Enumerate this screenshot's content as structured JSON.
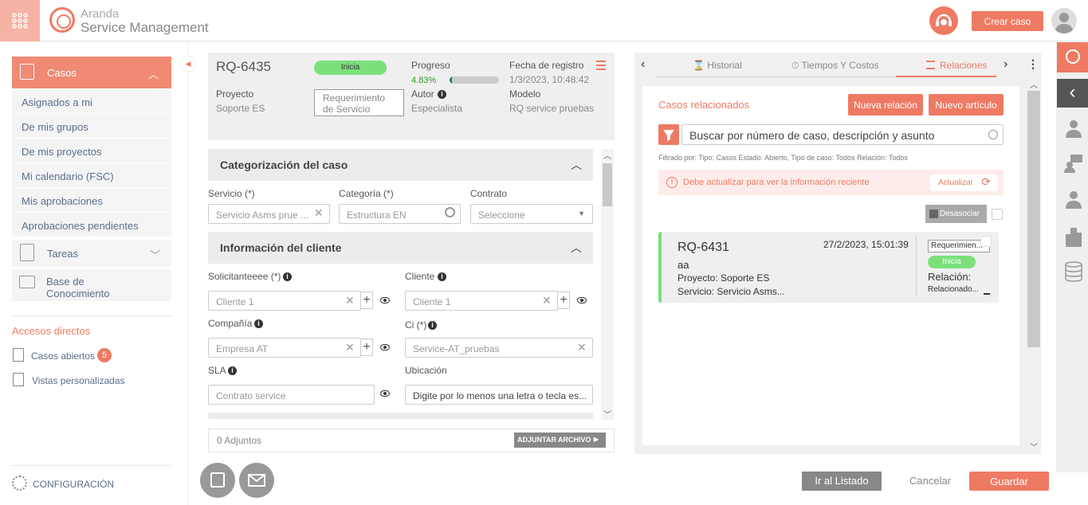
{
  "header": {
    "brand_top": "Aranda",
    "brand_bottom": "Service Management",
    "create_case": "Crear caso"
  },
  "sidebar": {
    "casos": "Casos",
    "items": [
      "Asignados a mi",
      "De mis grupos",
      "De mis proyectos",
      "Mi calendario (FSC)",
      "Mis aprobaciones",
      "Aprobaciones pendientes"
    ],
    "tareas": "Tareas",
    "base1": "Base de",
    "base2": "Conocimiento",
    "shortcuts_title": "Accesos directos",
    "open_cases": "Casos abiertos",
    "open_cases_count": "5",
    "custom_views": "Vistas personalizadas",
    "config": "CONFIGURACIÓN"
  },
  "case": {
    "id": "RQ-6435",
    "status": "Inicia",
    "progress_label": "Progreso",
    "progress_value": "4.83%",
    "progress_fraction": 0.0483,
    "reg_label": "Fecha de registro",
    "reg_value": "1/3/2023, 10:48:42",
    "project_label": "Proyecto",
    "project_value": "Soporte ES",
    "type1": "Requerimiento",
    "type2": "de Servicio",
    "author_label": "Autor",
    "author_value": "Especialista",
    "model_label": "Modelo",
    "model_value": "RQ service pruebas"
  },
  "categorization": {
    "title": "Categorización del caso",
    "service_label": "Servicio (*)",
    "service_value": "Servicio Asms prue ...",
    "category_label": "Categoría (*)",
    "category_value": "Estructura EN",
    "contract_label": "Contrato",
    "contract_value": "Seleccione"
  },
  "client": {
    "title": "Información del cliente",
    "requester_label": "Solicitanteeee (*)",
    "requester_value": "Cliente 1",
    "client_label": "Cliente",
    "client_value": "Cliente 1",
    "company_label": "Compañía",
    "company_value": "Empresa AT",
    "ci_label": "Ci (*)",
    "ci_value": "Service-AT_pruebas",
    "sla_label": "SLA",
    "sla_value": "Contrato service",
    "location_label": "Ubicación",
    "location_value": "Digite por lo menos una letra o tecla es..."
  },
  "attachments": {
    "label": "0 Adjuntos",
    "button": "ADJUNTAR ARCHIVO"
  },
  "tabs": {
    "history": "Historial",
    "times": "Tiempos Y Costos",
    "relations": "Relaciones"
  },
  "relations": {
    "title": "Casos relacionados",
    "new_relation": "Nueva relación",
    "new_article": "Nuevo artículo",
    "search_placeholder": "Buscar por número de caso, descripción y asunto",
    "filter_text": "Filtrado por: Tipo: Casos Estado: Abierto, Tipo de caso: Todos Relación: Todos",
    "alert": "Debe actualizar para ver la información reciente",
    "update": "Actualizar",
    "unlink": "Desasociar"
  },
  "related_card": {
    "id": "RQ-6431",
    "date": "27/2/2023, 15:01:39",
    "subject": "aa",
    "project": "Proyecto: Soporte ES",
    "service": "Servicio: Servicio Asms...",
    "type": "Requerimien...",
    "status": "Inicia",
    "relation_label": "Relación:",
    "relation_value": "Relacionado..."
  },
  "footer": {
    "to_list": "Ir al Listado",
    "cancel": "Cancelar",
    "save": "Guardar"
  },
  "colors": {
    "accent": "#ef7a63",
    "status_green": "#7be07b"
  }
}
